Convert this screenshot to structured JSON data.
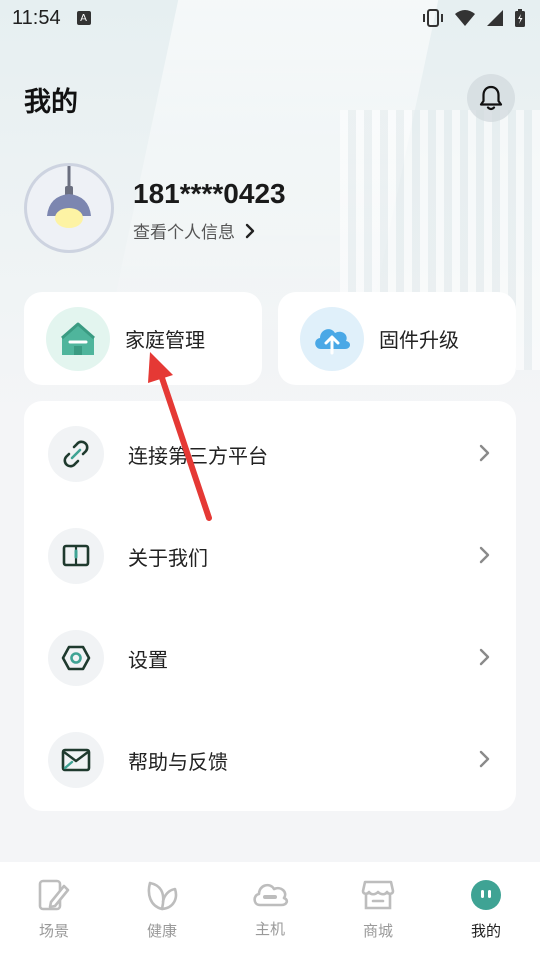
{
  "status_bar": {
    "time": "11:54",
    "notification": "A"
  },
  "header": {
    "title": "我的"
  },
  "profile": {
    "phone": "181****0423",
    "link_label": "查看个人信息"
  },
  "quick_actions": [
    {
      "label": "家庭管理",
      "icon": "home-icon"
    },
    {
      "label": "固件升级",
      "icon": "cloud-upload-icon"
    }
  ],
  "menu": [
    {
      "label": "连接第三方平台",
      "icon": "link-icon"
    },
    {
      "label": "关于我们",
      "icon": "book-icon"
    },
    {
      "label": "设置",
      "icon": "hexagon-settings-icon"
    },
    {
      "label": "帮助与反馈",
      "icon": "mail-icon"
    }
  ],
  "tabs": [
    {
      "label": "场景",
      "icon": "scene-icon",
      "active": false
    },
    {
      "label": "健康",
      "icon": "leaf-icon",
      "active": false
    },
    {
      "label": "主机",
      "icon": "cloud-host-icon",
      "active": false
    },
    {
      "label": "商城",
      "icon": "store-icon",
      "active": false
    },
    {
      "label": "我的",
      "icon": "profile-face-icon",
      "active": true
    }
  ],
  "colors": {
    "accent_teal": "#3fa394",
    "annotation_red": "#e53935",
    "icon_dark": "#1f3a2e"
  }
}
